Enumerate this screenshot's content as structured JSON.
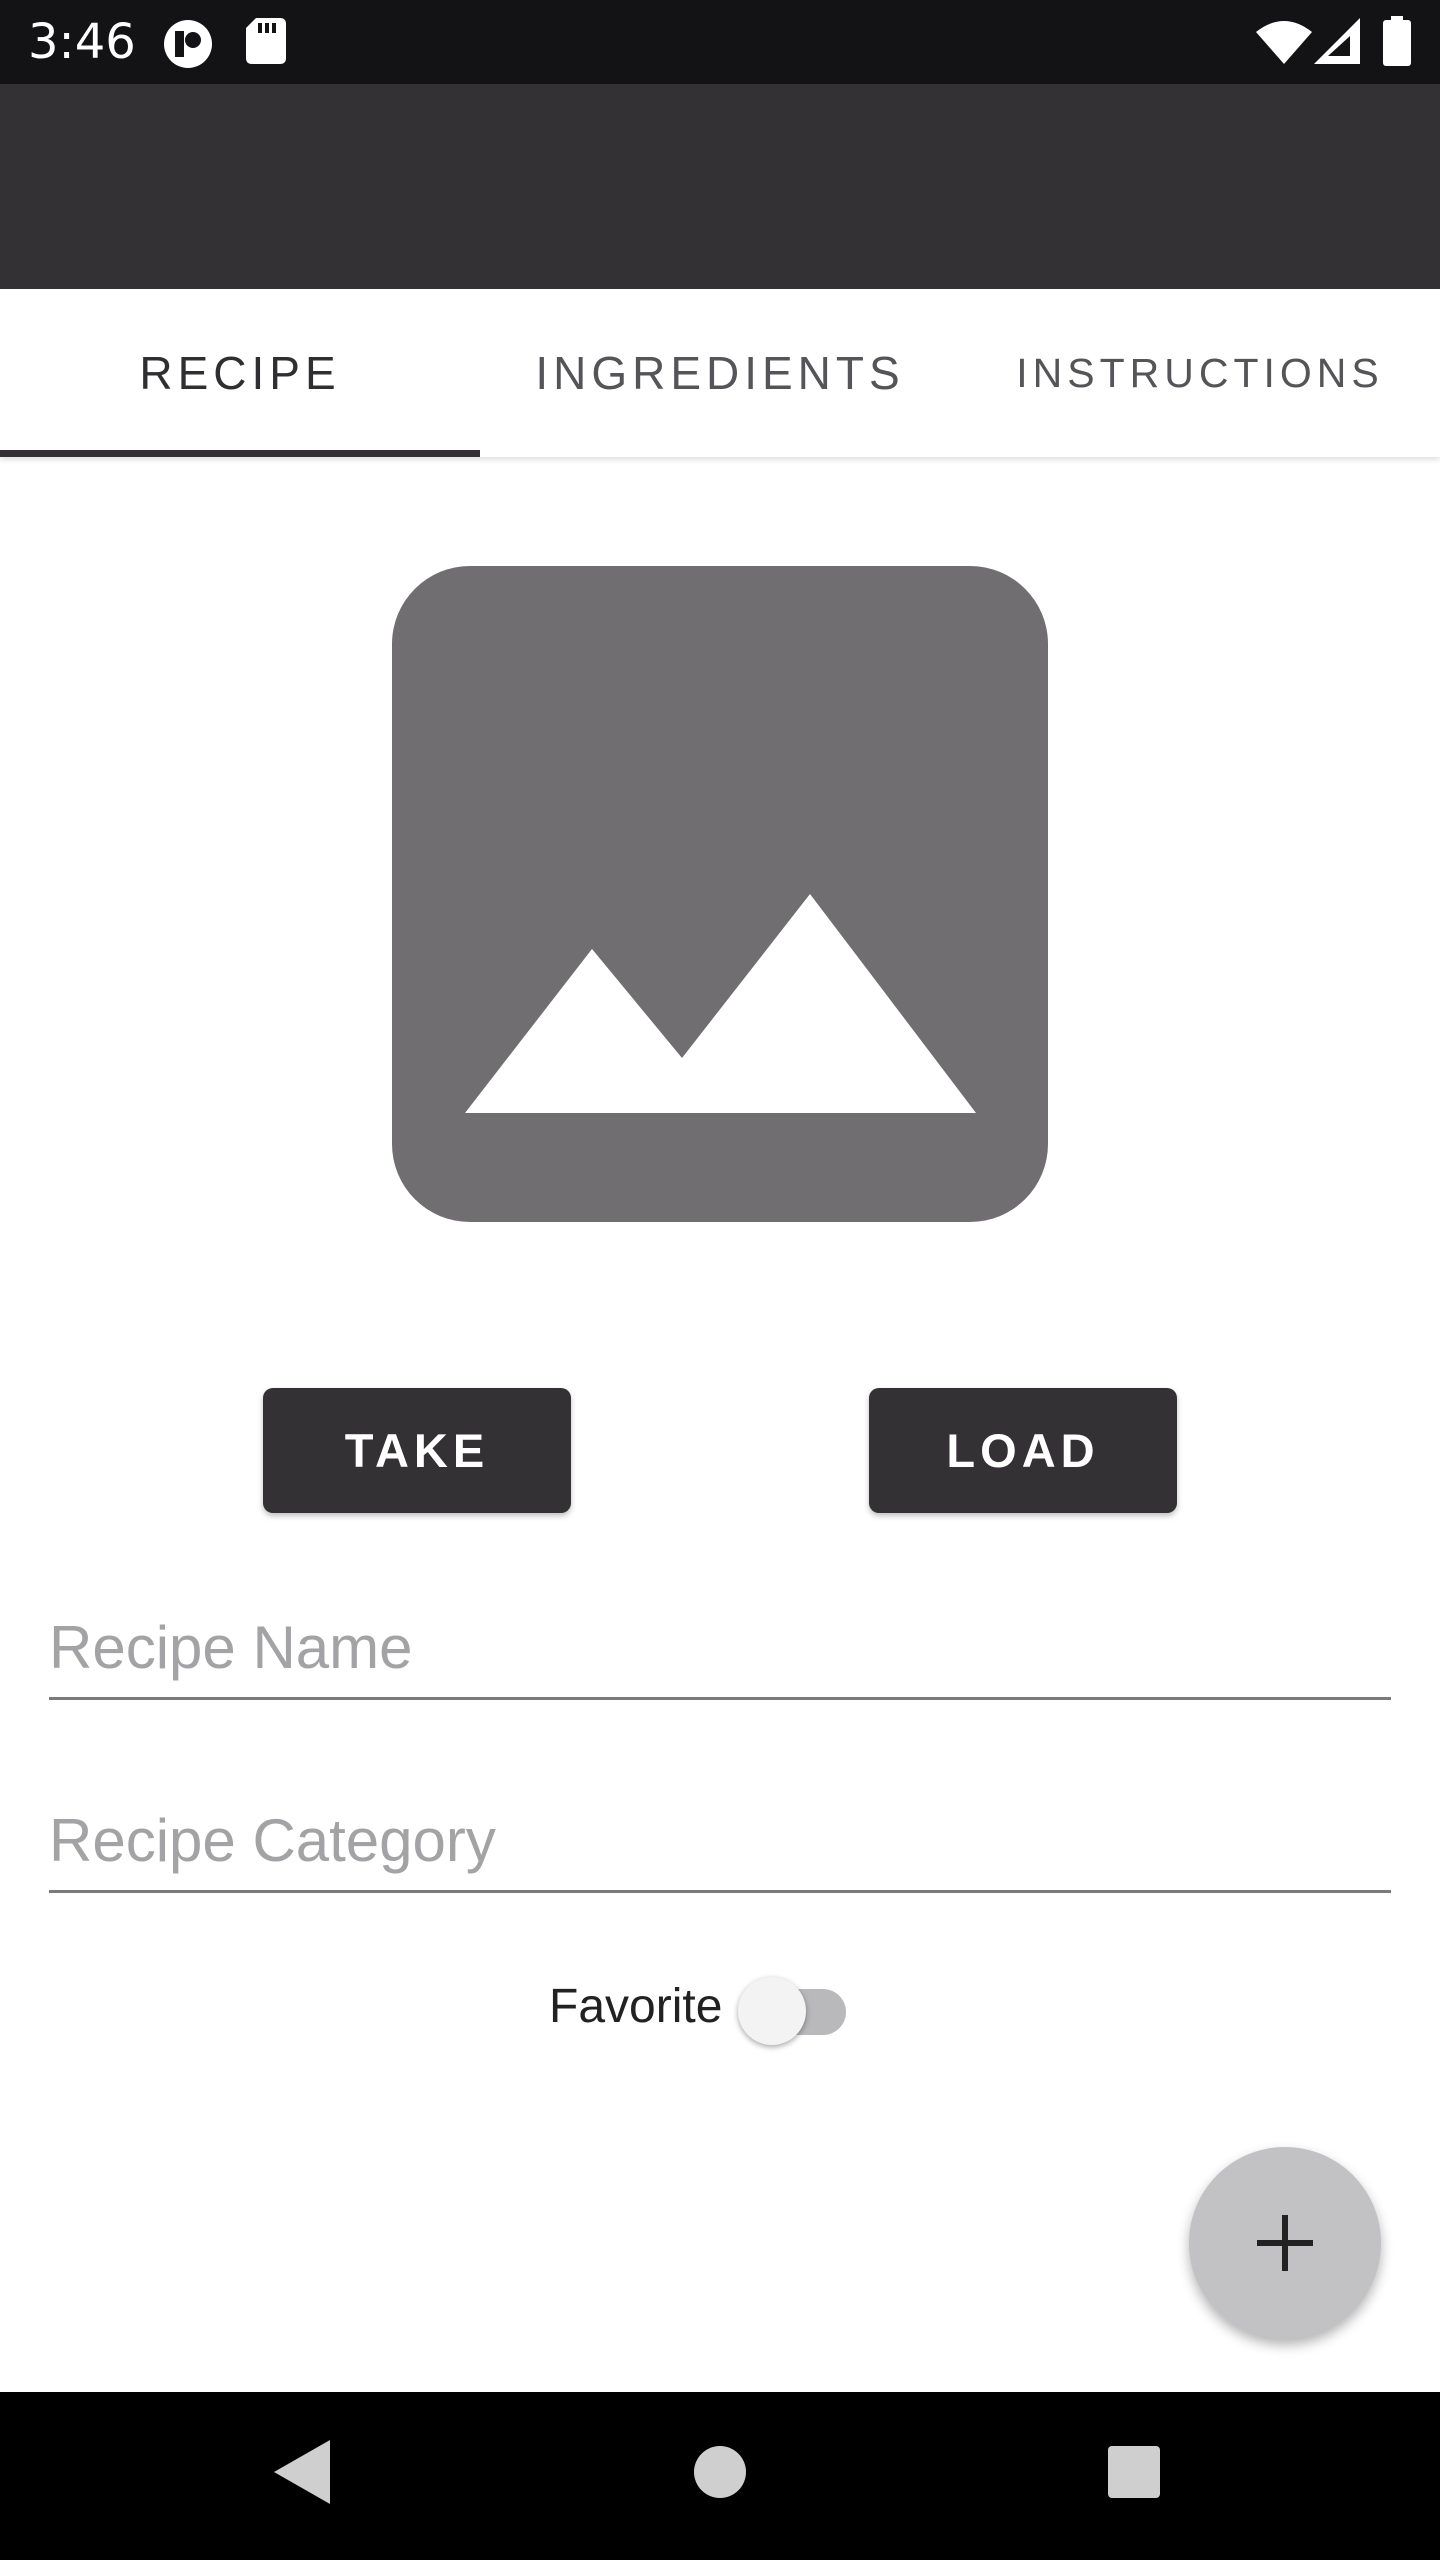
{
  "status_bar": {
    "time": "3:46",
    "icons": [
      "cast-icon",
      "sd-card-icon",
      "wifi-icon",
      "signal-icon",
      "battery-icon"
    ]
  },
  "app_bar": {
    "background": "#333133"
  },
  "tabs": [
    {
      "label": "RECIPE",
      "active": true
    },
    {
      "label": "INGREDIENTS",
      "active": false
    },
    {
      "label": "INSTRUCTIONS",
      "active": false
    }
  ],
  "image_placeholder": {
    "icon": "image-placeholder-icon",
    "color": "#706e70"
  },
  "buttons": {
    "take_label": "TAKE",
    "load_label": "LOAD"
  },
  "form": {
    "recipe_name_placeholder": "Recipe Name",
    "recipe_name_value": "",
    "recipe_category_placeholder": "Recipe Category",
    "recipe_category_value": "",
    "favorite_label": "Favorite",
    "favorite_on": false
  },
  "fab": {
    "icon": "plus-icon"
  },
  "nav_bar": {
    "icons": [
      "back-icon",
      "home-icon",
      "recents-icon"
    ]
  }
}
